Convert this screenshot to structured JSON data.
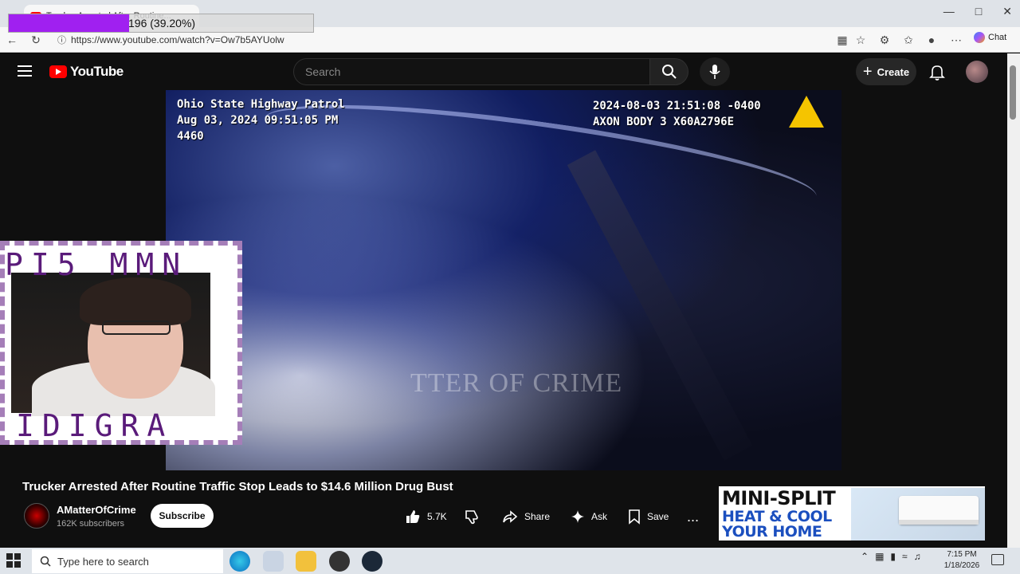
{
  "browser": {
    "tab_title": "Trucker Arrested After Routine...",
    "url": "https://www.youtube.com/watch?v=Ow7b5AYUolw",
    "chat_label": "Chat",
    "download_progress": {
      "text": "196 (39.20%)",
      "fraction": 0.392,
      "color": "#a020f0"
    }
  },
  "youtube": {
    "logo_text": "YouTube",
    "search_placeholder": "Search",
    "create_label": "Create"
  },
  "video": {
    "overlay_left": [
      "Ohio State Highway Patrol",
      "Aug 03, 2024 09:51:05 PM",
      "4460"
    ],
    "overlay_right": [
      "2024-08-03 21:51:08 -0400",
      "AXON BODY 3 X60A2796E"
    ],
    "watermark": "TTER OF CRIME"
  },
  "webcam": {
    "glitch_top": "PI5 MMN",
    "glitch_bottom": "IDIGRA"
  },
  "details": {
    "title": "Trucker Arrested After Routine Traffic Stop Leads to $14.6 Million Drug Bust",
    "channel_name": "AMatterOfCrime",
    "subscribers": "162K subscribers",
    "subscribe_label": "Subscribe",
    "likes": "5.7K",
    "share_label": "Share",
    "ask_label": "Ask",
    "save_label": "Save",
    "more_label": "..."
  },
  "ad": {
    "line1": "MINI-SPLIT",
    "line2": "HEAT & COOL",
    "line3": "YOUR HOME"
  },
  "taskbar": {
    "search_placeholder": "Type here to search",
    "time": "7:15 PM",
    "date": "1/18/2026"
  },
  "colors": {
    "youtube_red": "#ff0000",
    "page_bg": "#0f0f0f",
    "ad_blue": "#1b4fbf"
  }
}
